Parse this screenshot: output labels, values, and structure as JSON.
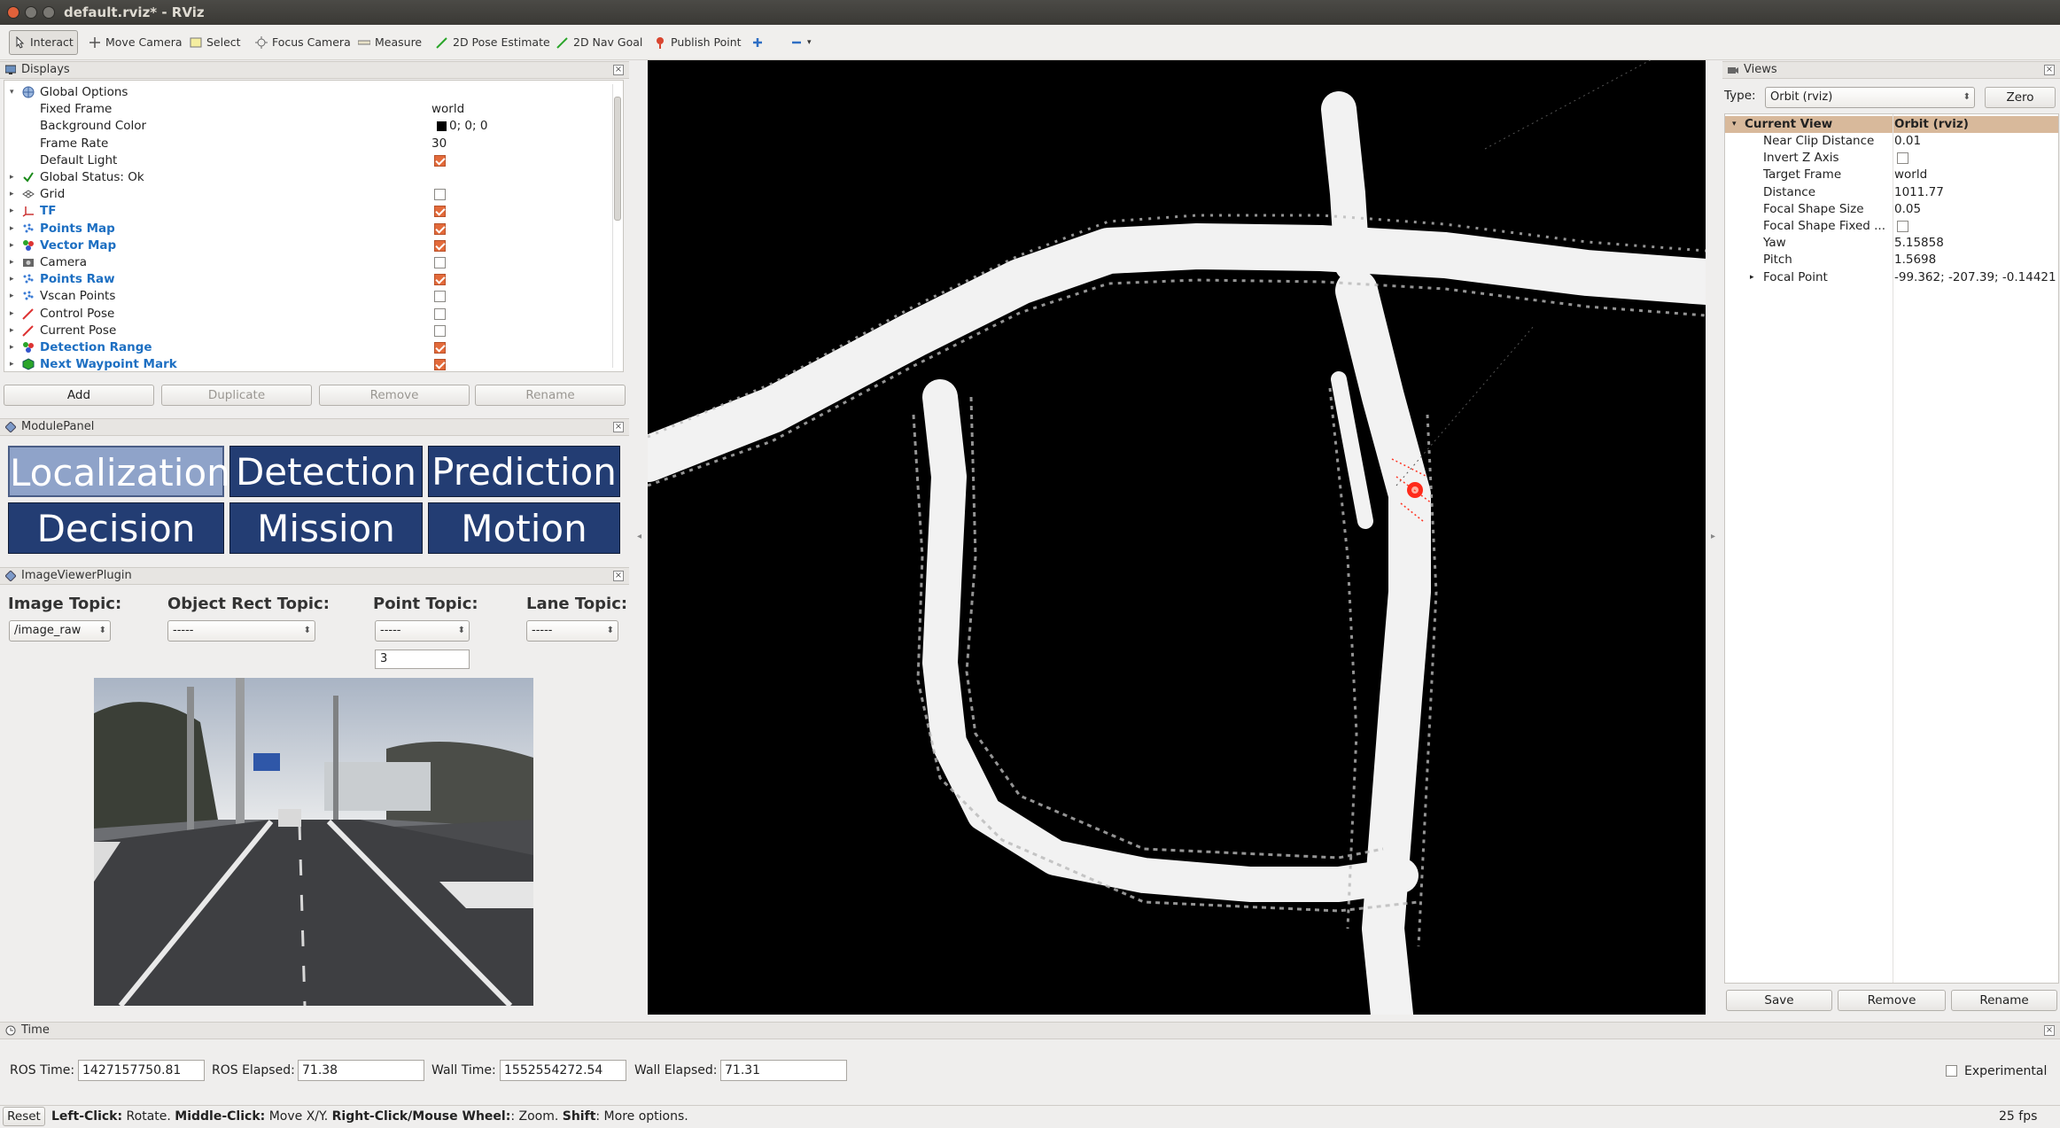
{
  "window": {
    "title": "default.rviz* - RViz"
  },
  "toolbar": {
    "tools": [
      {
        "label": "Interact",
        "icon": "cursor-icon"
      },
      {
        "label": "Move Camera",
        "icon": "move-camera-icon"
      },
      {
        "label": "Select",
        "icon": "select-icon"
      },
      {
        "label": "Focus Camera",
        "icon": "focus-camera-icon"
      },
      {
        "label": "Measure",
        "icon": "ruler-icon"
      },
      {
        "label": "2D Pose Estimate",
        "icon": "green-arrow-icon"
      },
      {
        "label": "2D Nav Goal",
        "icon": "green-arrow-icon"
      },
      {
        "label": "Publish Point",
        "icon": "map-pin-icon"
      }
    ]
  },
  "displays": {
    "title": "Displays",
    "rows": [
      {
        "label": "Global Options",
        "arrow": "▾",
        "indent": 0,
        "icon": "globe"
      },
      {
        "label": "Fixed Frame",
        "indent": 1,
        "value": "world"
      },
      {
        "label": "Background Color",
        "indent": 1,
        "value": "0; 0; 0",
        "swatch": true
      },
      {
        "label": "Frame Rate",
        "indent": 1,
        "value": "30"
      },
      {
        "label": "Default Light",
        "indent": 1,
        "check": true
      },
      {
        "label": "Global Status: Ok",
        "arrow": "▸",
        "indent": 0,
        "icon": "check"
      },
      {
        "label": "Grid",
        "arrow": "▸",
        "indent": 0,
        "icon": "grid",
        "check": false
      },
      {
        "label": "TF",
        "arrow": "▸",
        "indent": 0,
        "icon": "tf",
        "check": true,
        "blue": true
      },
      {
        "label": "Points Map",
        "arrow": "▸",
        "indent": 0,
        "icon": "points",
        "check": true,
        "blue": true
      },
      {
        "label": "Vector Map",
        "arrow": "▸",
        "indent": 0,
        "icon": "marker",
        "check": true,
        "blue": true
      },
      {
        "label": "Camera",
        "arrow": "▸",
        "indent": 0,
        "icon": "camera",
        "check": false
      },
      {
        "label": "Points Raw",
        "arrow": "▸",
        "indent": 0,
        "icon": "points",
        "check": true,
        "blue": true
      },
      {
        "label": "Vscan Points",
        "arrow": "▸",
        "indent": 0,
        "icon": "points",
        "check": false
      },
      {
        "label": "Control Pose",
        "arrow": "▸",
        "indent": 0,
        "icon": "pose",
        "check": false
      },
      {
        "label": "Current Pose",
        "arrow": "▸",
        "indent": 0,
        "icon": "pose",
        "check": false
      },
      {
        "label": "Detection Range",
        "arrow": "▸",
        "indent": 0,
        "icon": "marker",
        "check": true,
        "blue": true
      },
      {
        "label": "Next Waypoint Mark",
        "arrow": "▸",
        "indent": 0,
        "icon": "cube",
        "check": true,
        "blue": true
      }
    ],
    "buttons": {
      "add": "Add",
      "duplicate": "Duplicate",
      "remove": "Remove",
      "rename": "Rename"
    }
  },
  "module_panel": {
    "title": "ModulePanel",
    "modules": [
      "Localization",
      "Detection",
      "Prediction",
      "Decision",
      "Mission",
      "Motion"
    ]
  },
  "image_viewer": {
    "title": "ImageViewerPlugin",
    "image_topic_label": "Image Topic:",
    "object_rect_label": "Object Rect Topic:",
    "point_topic_label": "Point Topic:",
    "lane_topic_label": "Lane Topic:",
    "image_topic_value": "/image_raw",
    "object_rect_value": "-----",
    "point_topic_value": "-----",
    "lane_topic_value": "-----",
    "point_size": "3"
  },
  "views": {
    "title": "Views",
    "type_label": "Type:",
    "type_value": "Orbit (rviz)",
    "zero_label": "Zero",
    "current_view_label": "Current View",
    "current_view_value": "Orbit (rviz)",
    "props": [
      {
        "k": "Near Clip Distance",
        "v": "0.01"
      },
      {
        "k": "Invert Z Axis",
        "check": false
      },
      {
        "k": "Target Frame",
        "v": "world"
      },
      {
        "k": "Distance",
        "v": "1011.77"
      },
      {
        "k": "Focal Shape Size",
        "v": "0.05"
      },
      {
        "k": "Focal Shape Fixed ...",
        "check": false
      },
      {
        "k": "Yaw",
        "v": "5.15858"
      },
      {
        "k": "Pitch",
        "v": "1.5698"
      },
      {
        "k": "Focal Point",
        "v": "-99.362; -207.39; -0.14421",
        "arrow": true
      }
    ],
    "buttons": {
      "save": "Save",
      "remove": "Remove",
      "rename": "Rename"
    }
  },
  "time": {
    "title": "Time",
    "ros_time_label": "ROS Time:",
    "ros_time": "1427157750.81",
    "ros_elapsed_label": "ROS Elapsed:",
    "ros_elapsed": "71.38",
    "wall_time_label": "Wall Time:",
    "wall_time": "1552554272.54",
    "wall_elapsed_label": "Wall Elapsed:",
    "wall_elapsed": "71.31",
    "experimental_label": "Experimental"
  },
  "statusbar": {
    "reset": "Reset",
    "hint_parts": [
      {
        "t": "Left-Click:",
        "b": true
      },
      {
        "t": " Rotate. "
      },
      {
        "t": "Middle-Click:",
        "b": true
      },
      {
        "t": " Move X/Y. "
      },
      {
        "t": "Right-Click/Mouse Wheel:",
        "b": true
      },
      {
        "t": ": Zoom. "
      },
      {
        "t": "Shift",
        "b": true
      },
      {
        "t": ": More options."
      }
    ],
    "fps": "25 fps"
  }
}
